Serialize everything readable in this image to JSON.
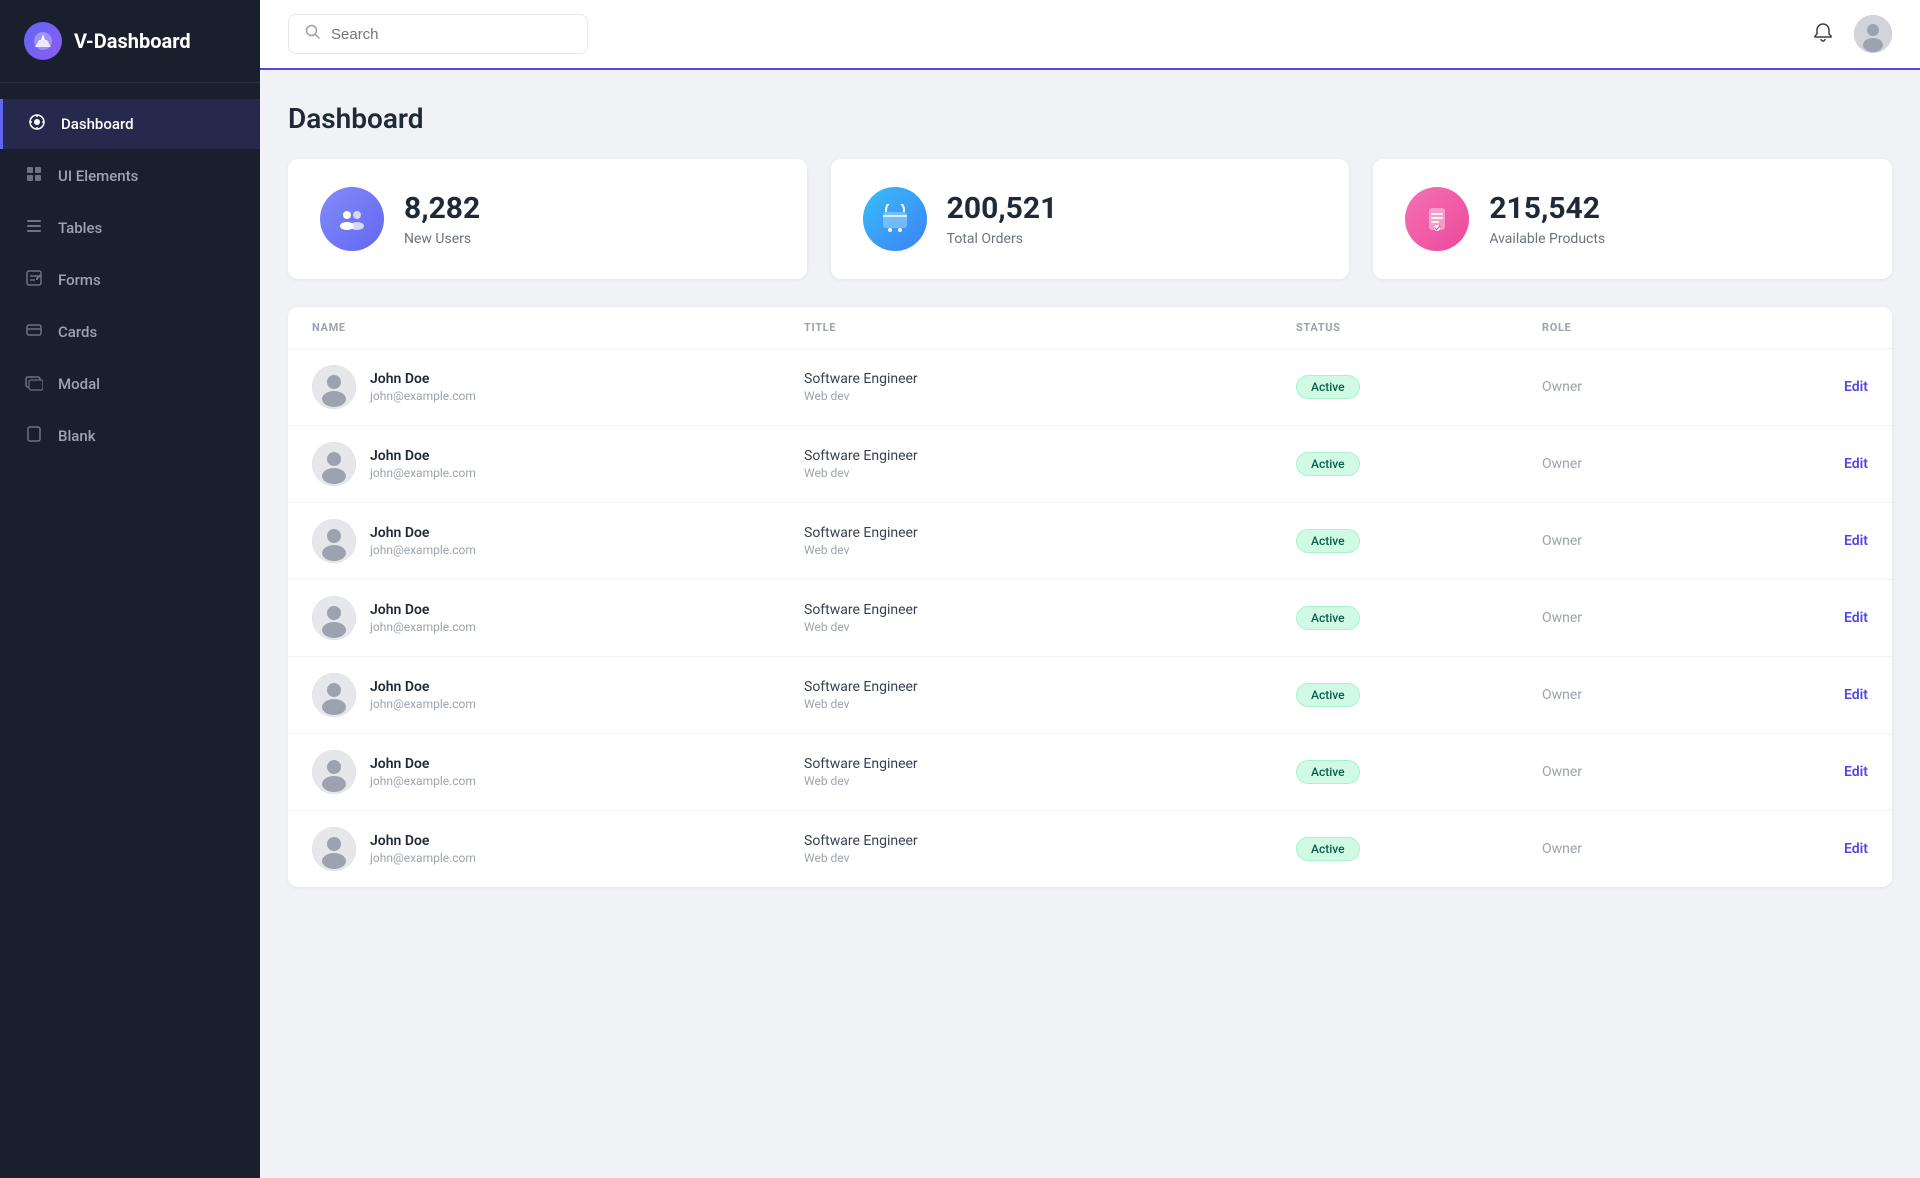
{
  "app": {
    "name": "V-Dashboard",
    "logo_emoji": "🔥"
  },
  "sidebar": {
    "items": [
      {
        "id": "dashboard",
        "label": "Dashboard",
        "icon": "⊙",
        "active": true
      },
      {
        "id": "ui-elements",
        "label": "UI Elements",
        "icon": "⊞",
        "active": false
      },
      {
        "id": "tables",
        "label": "Tables",
        "icon": "☰",
        "active": false
      },
      {
        "id": "forms",
        "label": "Forms",
        "icon": "✏",
        "active": false
      },
      {
        "id": "cards",
        "label": "Cards",
        "icon": "▬",
        "active": false
      },
      {
        "id": "modal",
        "label": "Modal",
        "icon": "◫",
        "active": false
      },
      {
        "id": "blank",
        "label": "Blank",
        "icon": "⬜",
        "active": false
      }
    ]
  },
  "topbar": {
    "search_placeholder": "Search",
    "bell_label": "Notifications"
  },
  "page": {
    "title": "Dashboard"
  },
  "stats": [
    {
      "id": "users",
      "number": "8,282",
      "label": "New Users",
      "icon": "👥",
      "color_class": "purple"
    },
    {
      "id": "orders",
      "number": "200,521",
      "label": "Total Orders",
      "icon": "🛒",
      "color_class": "blue"
    },
    {
      "id": "products",
      "number": "215,542",
      "label": "Available Products",
      "icon": "🔒",
      "color_class": "pink"
    }
  ],
  "table": {
    "columns": [
      "NAME",
      "TITLE",
      "STATUS",
      "ROLE",
      ""
    ],
    "rows": [
      {
        "name": "John Doe",
        "email": "john@example.com",
        "title": "Software Engineer",
        "subtitle": "Web dev",
        "status": "Active",
        "role": "Owner",
        "edit": "Edit"
      },
      {
        "name": "John Doe",
        "email": "john@example.com",
        "title": "Software Engineer",
        "subtitle": "Web dev",
        "status": "Active",
        "role": "Owner",
        "edit": "Edit"
      },
      {
        "name": "John Doe",
        "email": "john@example.com",
        "title": "Software Engineer",
        "subtitle": "Web dev",
        "status": "Active",
        "role": "Owner",
        "edit": "Edit"
      },
      {
        "name": "John Doe",
        "email": "john@example.com",
        "title": "Software Engineer",
        "subtitle": "Web dev",
        "status": "Active",
        "role": "Owner",
        "edit": "Edit"
      },
      {
        "name": "John Doe",
        "email": "john@example.com",
        "title": "Software Engineer",
        "subtitle": "Web dev",
        "status": "Active",
        "role": "Owner",
        "edit": "Edit"
      },
      {
        "name": "John Doe",
        "email": "john@example.com",
        "title": "Software Engineer",
        "subtitle": "Web dev",
        "status": "Active",
        "role": "Owner",
        "edit": "Edit"
      },
      {
        "name": "John Doe",
        "email": "john@example.com",
        "title": "Software Engineer",
        "subtitle": "Web dev",
        "status": "Active",
        "role": "Owner",
        "edit": "Edit"
      }
    ]
  }
}
